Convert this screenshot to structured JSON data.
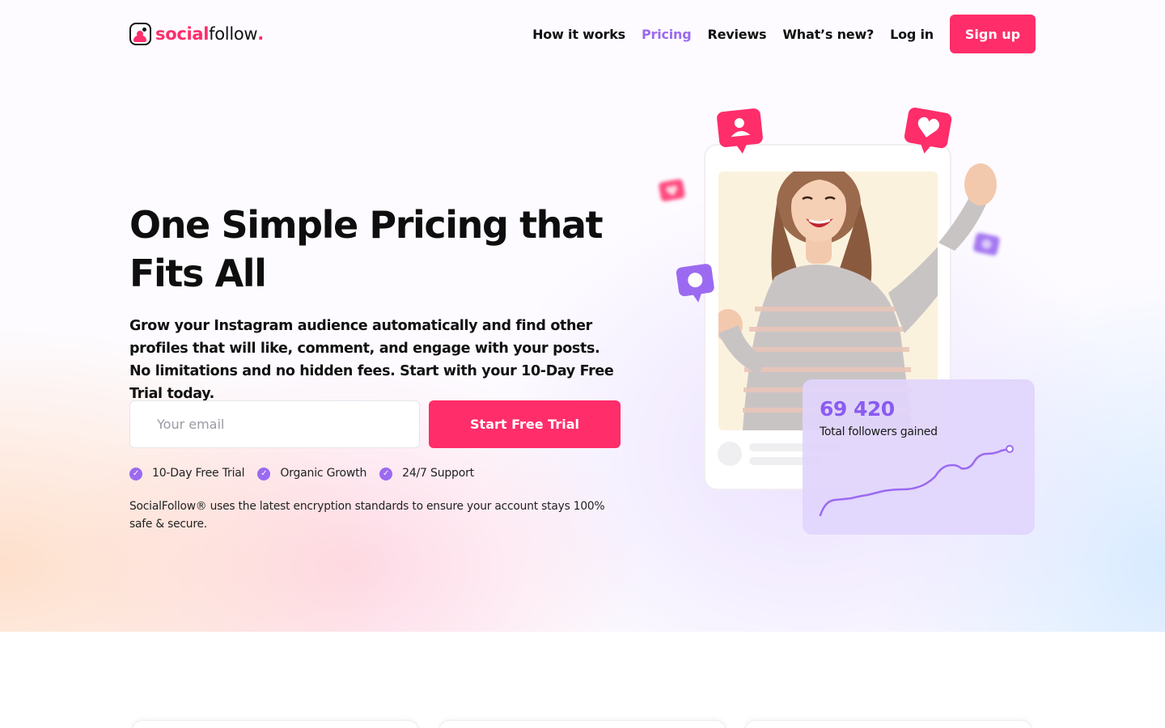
{
  "brand": {
    "name_bold": "social",
    "name_light": "follow",
    "name_dot": "."
  },
  "nav": {
    "items": [
      {
        "label": "How it works",
        "active": false
      },
      {
        "label": "Pricing",
        "active": true
      },
      {
        "label": "Reviews",
        "active": false
      },
      {
        "label": "What’s new?",
        "active": false
      },
      {
        "label": "Log in",
        "active": false
      }
    ],
    "signup_label": "Sign up"
  },
  "hero": {
    "title_line1": "One Simple Pricing that",
    "title_line2": "Fits All",
    "subtitle": "Grow your Instagram audience automatically and find other profiles that will like, comment, and engage with your posts. No limitations and no hidden fees. Start with your 10-Day Free Trial today.",
    "email_placeholder": "Your email",
    "cta_label": "Start Free Trial",
    "features": [
      "10-Day Free Trial",
      "Organic Growth",
      "24/7 Support"
    ],
    "security_note": "SocialFollow® uses the latest encryption standards to ensure your account stays 100% safe & secure."
  },
  "stats_card": {
    "value": "69 420",
    "label": "Total followers gained"
  },
  "colors": {
    "accent": "#ff2d6a",
    "purple": "#9b6af0",
    "stats_bg": "#e1d5fc"
  },
  "icons": [
    "logo-icon",
    "user-bubble-icon",
    "heart-bubble-icon",
    "comment-bubble-icon",
    "check-icon"
  ]
}
